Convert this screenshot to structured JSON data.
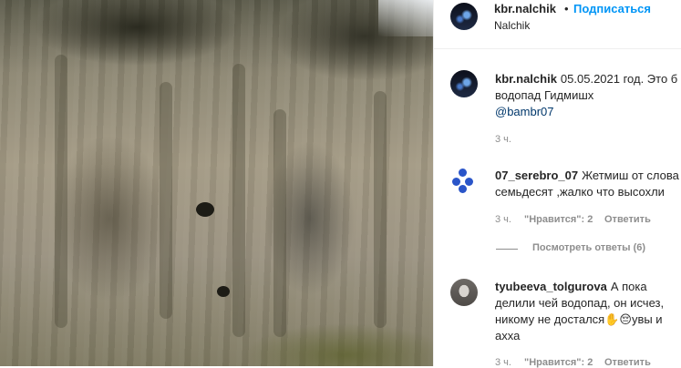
{
  "post": {
    "author": "kbr.nalchik",
    "separator": "•",
    "follow_label": "Подписаться",
    "location": "Nalchik"
  },
  "caption": {
    "username": "kbr.nalchik",
    "text": "05.05.2021 год. Это б водопад Гидмишх",
    "mention": "@bambr07",
    "time": "3 ч."
  },
  "comments": [
    {
      "username": "07_serebro_07",
      "text": "Жетмиш от слова семьдесят ,жалко что высохли",
      "time": "3 ч.",
      "likes": "\"Нравится\": 2",
      "reply_label": "Ответить",
      "view_replies": "Посмотреть ответы (6)"
    },
    {
      "username": "tyubeeva_tolgurova",
      "text": "А пока делили чей водопад, он исчез, никому не достался✋😔увы и ахха",
      "time": "3 ч.",
      "likes": "\"Нравится\": 2",
      "reply_label": "Ответить"
    }
  ],
  "colors": {
    "link": "#0095f6",
    "mention": "#00376b",
    "muted": "#8e8e8e",
    "text": "#262626"
  }
}
